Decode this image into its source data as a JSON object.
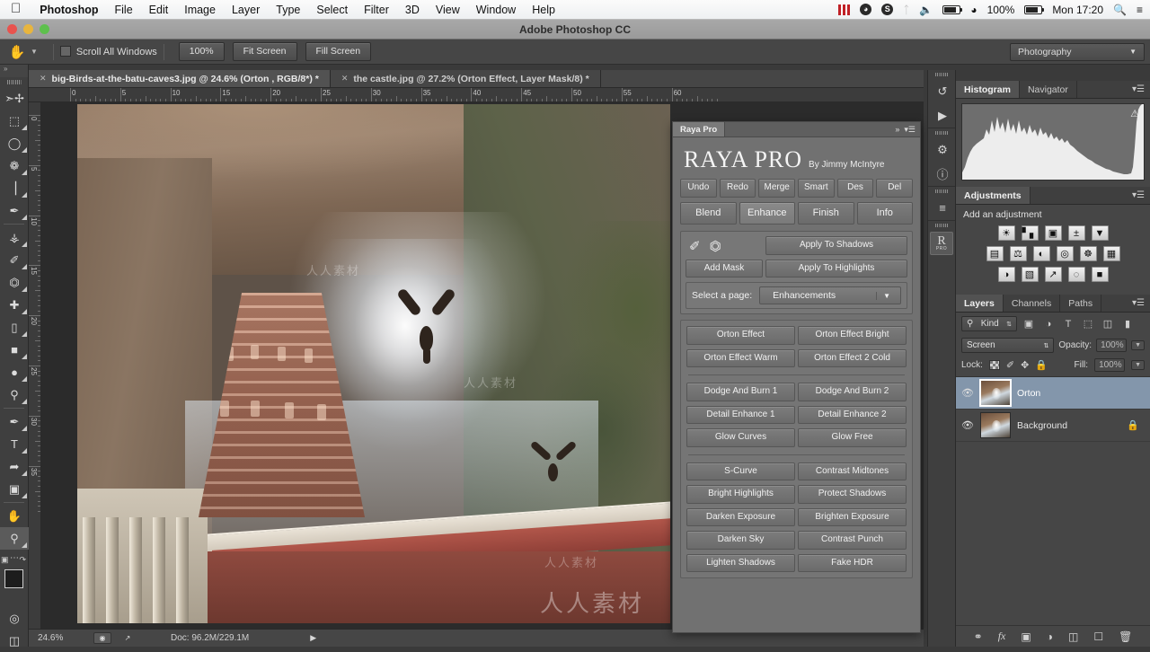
{
  "macbar": {
    "apple_icon": "apple-icon",
    "items": [
      "Photoshop",
      "File",
      "Edit",
      "Image",
      "Layer",
      "Type",
      "Select",
      "Filter",
      "3D",
      "View",
      "Window",
      "Help"
    ],
    "status": {
      "film_icon": "film-strip-icon",
      "clock_icon": "time-machine-icon",
      "sync_icon": "sync-icon",
      "bluetooth_icon": "bluetooth-icon",
      "volume_icon": "volume-icon",
      "battery_pct_icon": "battery-meter-icon",
      "wifi_icon": "wifi-icon",
      "battery_text": "100%",
      "charging_icon": "battery-charging-icon",
      "clock_text": "Mon 17:20",
      "search_icon": "spotlight-search-icon",
      "list_icon": "notification-center-icon"
    }
  },
  "titlebar": {
    "title": "Adobe Photoshop CC"
  },
  "optionsbar": {
    "tool_icon": "hand-tool-icon",
    "preset_caret": "chevron-down-icon",
    "scroll_all_label": "Scroll All Windows",
    "scroll_all_checked": false,
    "buttons": [
      "100%",
      "Fit Screen",
      "Fill Screen"
    ],
    "workspace": "Photography",
    "workspace_caret": "chevron-down-icon"
  },
  "toolbar": {
    "collapse_icon": "double-chevron-icon",
    "tools": [
      {
        "name": "move-tool",
        "glyph": "✣",
        "selected": false
      },
      {
        "name": "rectangular-marquee-tool",
        "glyph": "⬚",
        "selected": false
      },
      {
        "name": "lasso-tool",
        "glyph": "◯",
        "selected": false
      },
      {
        "name": "quick-selection-tool",
        "glyph": "❁",
        "selected": false
      },
      {
        "name": "crop-tool",
        "glyph": "⌗",
        "selected": false
      },
      {
        "name": "eyedropper-tool",
        "glyph": "✒",
        "selected": false
      },
      {
        "name": "spot-healing-brush-tool",
        "glyph": "⊕",
        "selected": false
      },
      {
        "name": "brush-tool",
        "glyph": "✎",
        "selected": false
      },
      {
        "name": "clone-stamp-tool",
        "glyph": "⚑",
        "selected": false
      },
      {
        "name": "history-brush-tool",
        "glyph": "✐",
        "selected": false
      },
      {
        "name": "eraser-tool",
        "glyph": "▱",
        "selected": false
      },
      {
        "name": "gradient-tool",
        "glyph": "■",
        "selected": false
      },
      {
        "name": "blur-tool",
        "glyph": "●",
        "selected": false
      },
      {
        "name": "dodge-tool",
        "glyph": "⚲",
        "selected": false
      },
      {
        "name": "pen-tool",
        "glyph": "✒",
        "selected": false
      },
      {
        "name": "horizontal-type-tool",
        "glyph": "T",
        "selected": false
      },
      {
        "name": "path-selection-tool",
        "glyph": "↖",
        "selected": false
      },
      {
        "name": "rectangle-tool",
        "glyph": "▣",
        "selected": false
      },
      {
        "name": "hand-tool",
        "glyph": "✋",
        "selected": false
      },
      {
        "name": "zoom-tool",
        "glyph": "⚲",
        "selected": true
      }
    ],
    "screen_mode_icon": "screen-mode-icon",
    "quickmask_icon": "quick-mask-icon"
  },
  "tabs": [
    {
      "label": "big-Birds-at-the-batu-caves3.jpg @ 24.6% (Orton , RGB/8*) *",
      "active": true
    },
    {
      "label": "the castle.jpg @ 27.2% (Orton Effect, Layer Mask/8) *",
      "active": false
    }
  ],
  "ruler": {
    "horizontal_labels": [
      "0",
      "5",
      "10",
      "15",
      "20",
      "25",
      "30",
      "35",
      "40",
      "45",
      "50",
      "55",
      "60"
    ],
    "vertical_labels": [
      "0",
      "5",
      "10",
      "15",
      "20",
      "25",
      "30",
      "35"
    ],
    "unit": "inches"
  },
  "canvas": {
    "watermark": "人人素材",
    "watermark_small": "人人素材"
  },
  "statusbar": {
    "zoom": "24.6%",
    "doc_info": "Doc: 96.2M/229.1M",
    "preview_icon": "preview-icon",
    "share_icon": "share-icon",
    "arrow_icon": "play-arrow-icon"
  },
  "raya": {
    "tab_label": "Raya Pro",
    "collapse_icon": "double-chevron-right-icon",
    "menu_icon": "panel-menu-icon",
    "logo": "RAYA PRO",
    "byline": "By Jimmy McIntyre",
    "toprow": [
      "Undo",
      "Redo",
      "Merge",
      "Smart",
      "Des",
      "Del"
    ],
    "sections": [
      "Blend",
      "Enhance",
      "Finish",
      "Info"
    ],
    "active_section": "Enhance",
    "brush_icon": "brush-icon",
    "stamp_icon": "stamp-icon",
    "add_mask": "Add Mask",
    "apply_shadows": "Apply To Shadows",
    "apply_highlights": "Apply To Highlights",
    "select_page_label": "Select a page:",
    "select_page_value": "Enhancements",
    "select_page_caret": "chevron-down-icon",
    "group1": [
      [
        "Orton Effect",
        "Orton Effect Bright"
      ],
      [
        "Orton Effect Warm",
        "Orton Effect 2 Cold"
      ]
    ],
    "group2": [
      [
        "Dodge And Burn 1",
        "Dodge And Burn 2"
      ],
      [
        "Detail Enhance 1",
        "Detail Enhance 2"
      ],
      [
        "Glow Curves",
        "Glow Free"
      ]
    ],
    "group3": [
      [
        "S-Curve",
        "Contrast Midtones"
      ],
      [
        "Bright Highlights",
        "Protect Shadows"
      ],
      [
        "Darken Exposure",
        "Brighten Exposure"
      ],
      [
        "Darken Sky",
        "Contrast Punch"
      ],
      [
        "Lighten Shadows",
        "Fake HDR"
      ]
    ]
  },
  "icondock": {
    "icons": [
      {
        "name": "history-icon",
        "glyph": "↺"
      },
      {
        "name": "play-actions-icon",
        "glyph": "▶"
      },
      {
        "name": "properties-icon",
        "glyph": "⚙"
      },
      {
        "name": "info-icon",
        "glyph": "ⓘ"
      },
      {
        "name": "actions-icon",
        "glyph": "≡"
      },
      {
        "name": "raya-pro-icon",
        "glyph": "R"
      }
    ],
    "raya_sub": "PRO"
  },
  "histogram": {
    "tabs": [
      "Histogram",
      "Navigator"
    ],
    "active_tab": "Histogram",
    "menu_icon": "panel-menu-icon",
    "warning_icon": "cached-data-warning-icon"
  },
  "adjustments": {
    "tab": "Adjustments",
    "menu_icon": "panel-menu-icon",
    "title": "Add an adjustment",
    "rows": [
      [
        {
          "name": "brightness-contrast-icon",
          "glyph": "☀"
        },
        {
          "name": "levels-icon",
          "glyph": "▐"
        },
        {
          "name": "curves-icon",
          "glyph": "⌗"
        },
        {
          "name": "exposure-icon",
          "glyph": "±"
        },
        {
          "name": "vibrance-icon",
          "glyph": "▽"
        }
      ],
      [
        {
          "name": "hue-saturation-icon",
          "glyph": "▤"
        },
        {
          "name": "color-balance-icon",
          "glyph": "⚖"
        },
        {
          "name": "black-white-icon",
          "glyph": "◐"
        },
        {
          "name": "photo-filter-icon",
          "glyph": "◎"
        },
        {
          "name": "channel-mixer-icon",
          "glyph": "⬤"
        },
        {
          "name": "color-lookup-icon",
          "glyph": "▒"
        }
      ],
      [
        {
          "name": "invert-icon",
          "glyph": "◑"
        },
        {
          "name": "posterize-icon",
          "glyph": "▧"
        },
        {
          "name": "threshold-icon",
          "glyph": "⌇"
        },
        {
          "name": "selective-color-icon",
          "glyph": "⋈"
        },
        {
          "name": "gradient-map-icon",
          "glyph": "■"
        }
      ]
    ]
  },
  "layers": {
    "tabs": [
      "Layers",
      "Channels",
      "Paths"
    ],
    "active_tab": "Layers",
    "menu_icon": "panel-menu-icon",
    "filter_kind": "Kind",
    "filter_search_icon": "search-icon",
    "filter_icons": [
      {
        "name": "filter-pixel-icon",
        "glyph": "▣"
      },
      {
        "name": "filter-adjustment-icon",
        "glyph": "◑"
      },
      {
        "name": "filter-type-icon",
        "glyph": "T"
      },
      {
        "name": "filter-shape-icon",
        "glyph": "⬚"
      },
      {
        "name": "filter-smart-object-icon",
        "glyph": "◫"
      }
    ],
    "filter_toggle_icon": "filter-power-toggle-icon",
    "blend_mode": "Screen",
    "opacity_label": "Opacity:",
    "opacity_value": "100%",
    "lock_label": "Lock:",
    "lock_icons": [
      {
        "name": "lock-transparency-icon",
        "glyph": ""
      },
      {
        "name": "lock-image-icon",
        "glyph": "✎"
      },
      {
        "name": "lock-position-icon",
        "glyph": "✥"
      },
      {
        "name": "lock-all-icon",
        "glyph": "🔒"
      }
    ],
    "fill_label": "Fill:",
    "fill_value": "100%",
    "items": [
      {
        "name": "Orton",
        "selected": true,
        "visible": true,
        "locked": false
      },
      {
        "name": "Background",
        "selected": false,
        "visible": true,
        "locked": true
      }
    ],
    "footer_icons": [
      {
        "name": "link-layers-icon",
        "glyph": "⚭"
      },
      {
        "name": "layer-style-icon",
        "glyph": "fx"
      },
      {
        "name": "add-layer-mask-icon",
        "glyph": "▣"
      },
      {
        "name": "new-adjustment-layer-icon",
        "glyph": "◑"
      },
      {
        "name": "new-group-icon",
        "glyph": "▱"
      },
      {
        "name": "new-layer-icon",
        "glyph": "❐"
      },
      {
        "name": "delete-layer-icon",
        "glyph": "🗑"
      }
    ]
  }
}
